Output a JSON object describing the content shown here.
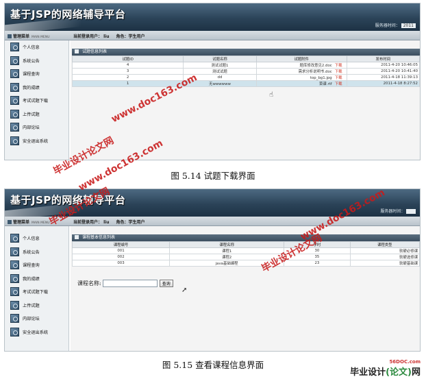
{
  "app_title": "基于JSP的网络辅导平台",
  "server_time_label": "服务器时间：",
  "server_time_value": "2011",
  "menu_header": "管理菜单",
  "menu_header_en": "MAIN MENU",
  "login_user_label": "当前登录用户： liu",
  "role_label": "角色：学生用户",
  "sidebar_items": [
    {
      "label": "个人信息",
      "icon": "person-icon"
    },
    {
      "label": "系统公告",
      "icon": "notice-icon"
    },
    {
      "label": "课程查询",
      "icon": "search-icon"
    },
    {
      "label": "我的成绩",
      "icon": "grade-icon"
    },
    {
      "label": "考试试题下载",
      "icon": "download-icon"
    },
    {
      "label": "上传试题",
      "icon": "upload-icon"
    },
    {
      "label": "内部论坛",
      "icon": "forum-icon"
    },
    {
      "label": "安全退出系统",
      "icon": "exit-icon"
    }
  ],
  "screen1": {
    "panel_title": "试题信息列表",
    "columns": [
      "试题ID",
      "试题名称",
      "试题附件",
      "发布时间"
    ],
    "rows": [
      {
        "id": "4",
        "name": "测试试题1",
        "file": "题库修改意见2.doc",
        "action": "下载",
        "time": "2011-4-20 10:46:05"
      },
      {
        "id": "3",
        "name": "测试试题",
        "file": "需求分析说明书.doc",
        "action": "下载",
        "time": "2011-4-20 10:41:40"
      },
      {
        "id": "2",
        "name": "dd",
        "file": "top_bg1.jpg",
        "action": "下载",
        "time": "2011-4-18 11:39:13"
      },
      {
        "id": "1",
        "name": "无wwwwww",
        "file": "菜谱.rtf",
        "action": "下载",
        "time": "2011-4-18 8:27:52"
      }
    ],
    "caption": "图 5.14 试题下载界面"
  },
  "screen2": {
    "panel_title": "课程基本信息列表",
    "columns": [
      "课程编号",
      "课程名称",
      "学时",
      "课程类型"
    ],
    "rows": [
      {
        "code": "001",
        "name": "课程1",
        "hours": "30",
        "type": "软硬必修课"
      },
      {
        "code": "002",
        "name": "课程2",
        "hours": "35",
        "type": "软硬选修课"
      },
      {
        "code": "003",
        "name": "java基础编程",
        "hours": "23",
        "type": "软硬基础课"
      }
    ],
    "search_label": "课程名称:",
    "search_value": "",
    "search_button": "查询",
    "caption": "图 5.15 查看课程信息界面"
  },
  "watermarks": {
    "site": "www.doc163.com",
    "slogan": "毕业设计论文网",
    "corner_site": "56DOC.com",
    "corner_brand_a": "毕业设计",
    "corner_brand_b": "(论文)",
    "corner_brand_c": "网"
  },
  "colors": {
    "banner": "#2b4358",
    "watermark": "#c81a1a",
    "highlight_row": "#cfe3ec",
    "download_link": "#d03a2a"
  }
}
